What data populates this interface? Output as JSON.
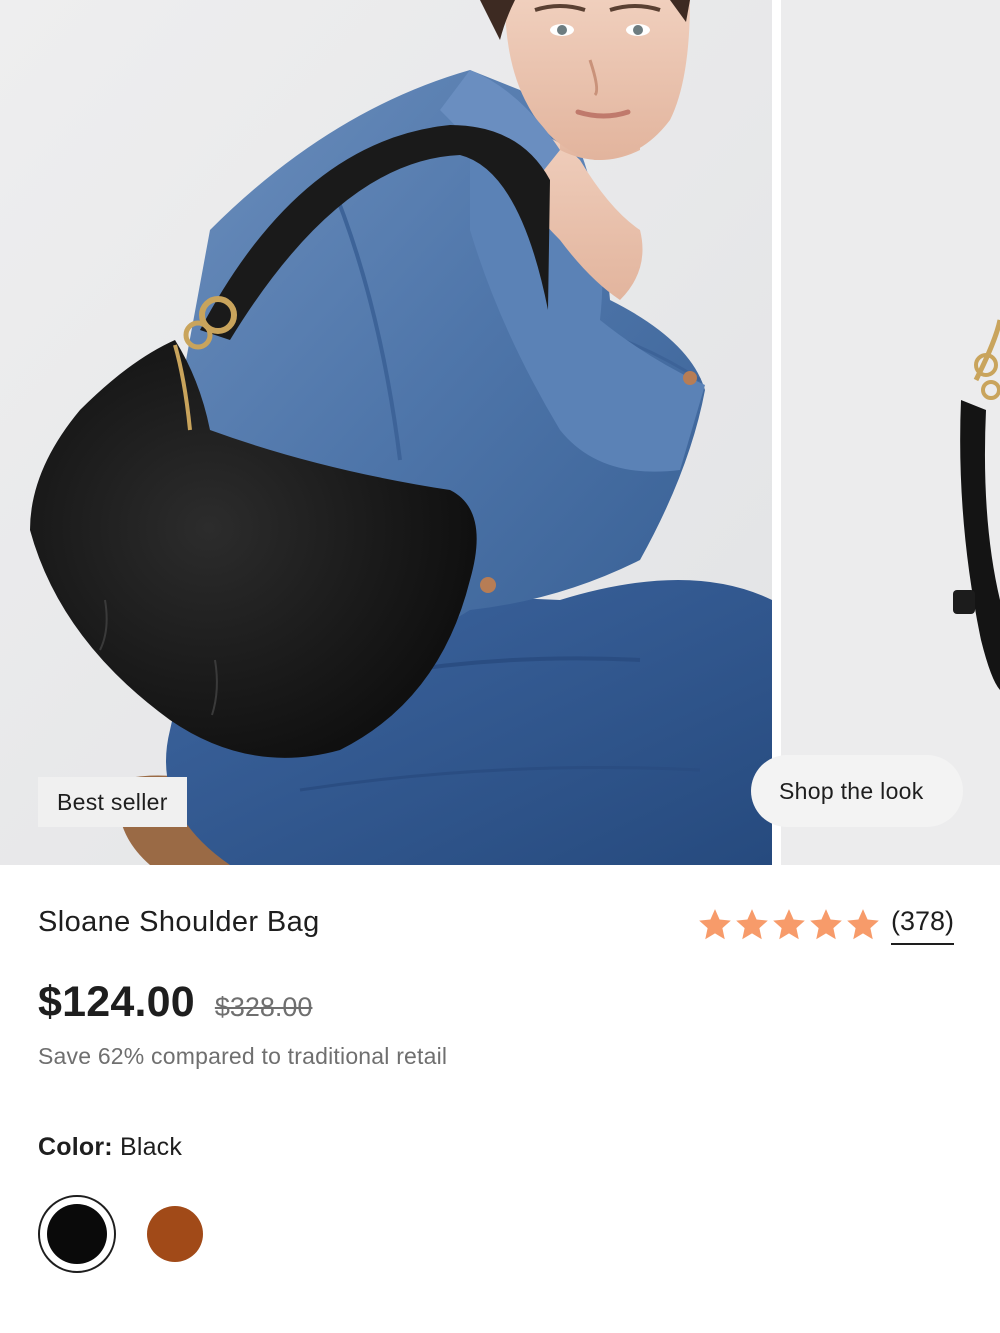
{
  "gallery": {
    "badge": "Best seller",
    "shop_the_look": "Shop the look"
  },
  "product": {
    "title": "Sloane Shoulder Bag",
    "rating": 5,
    "review_count": "(378)",
    "price": "$124.00",
    "compare_price": "$328.00",
    "savings": "Save 62% compared to traditional retail",
    "color_label": "Color:",
    "color_value": "Black"
  },
  "swatches": [
    {
      "name": "Black",
      "hex": "#0a0a0a",
      "selected": true
    },
    {
      "name": "Cognac",
      "hex": "#a14a18",
      "selected": false
    }
  ],
  "colors": {
    "star": "#f79b6a",
    "text": "#1e1e1e",
    "muted": "#6f6f6f"
  },
  "icons": {
    "star": "star-icon"
  }
}
